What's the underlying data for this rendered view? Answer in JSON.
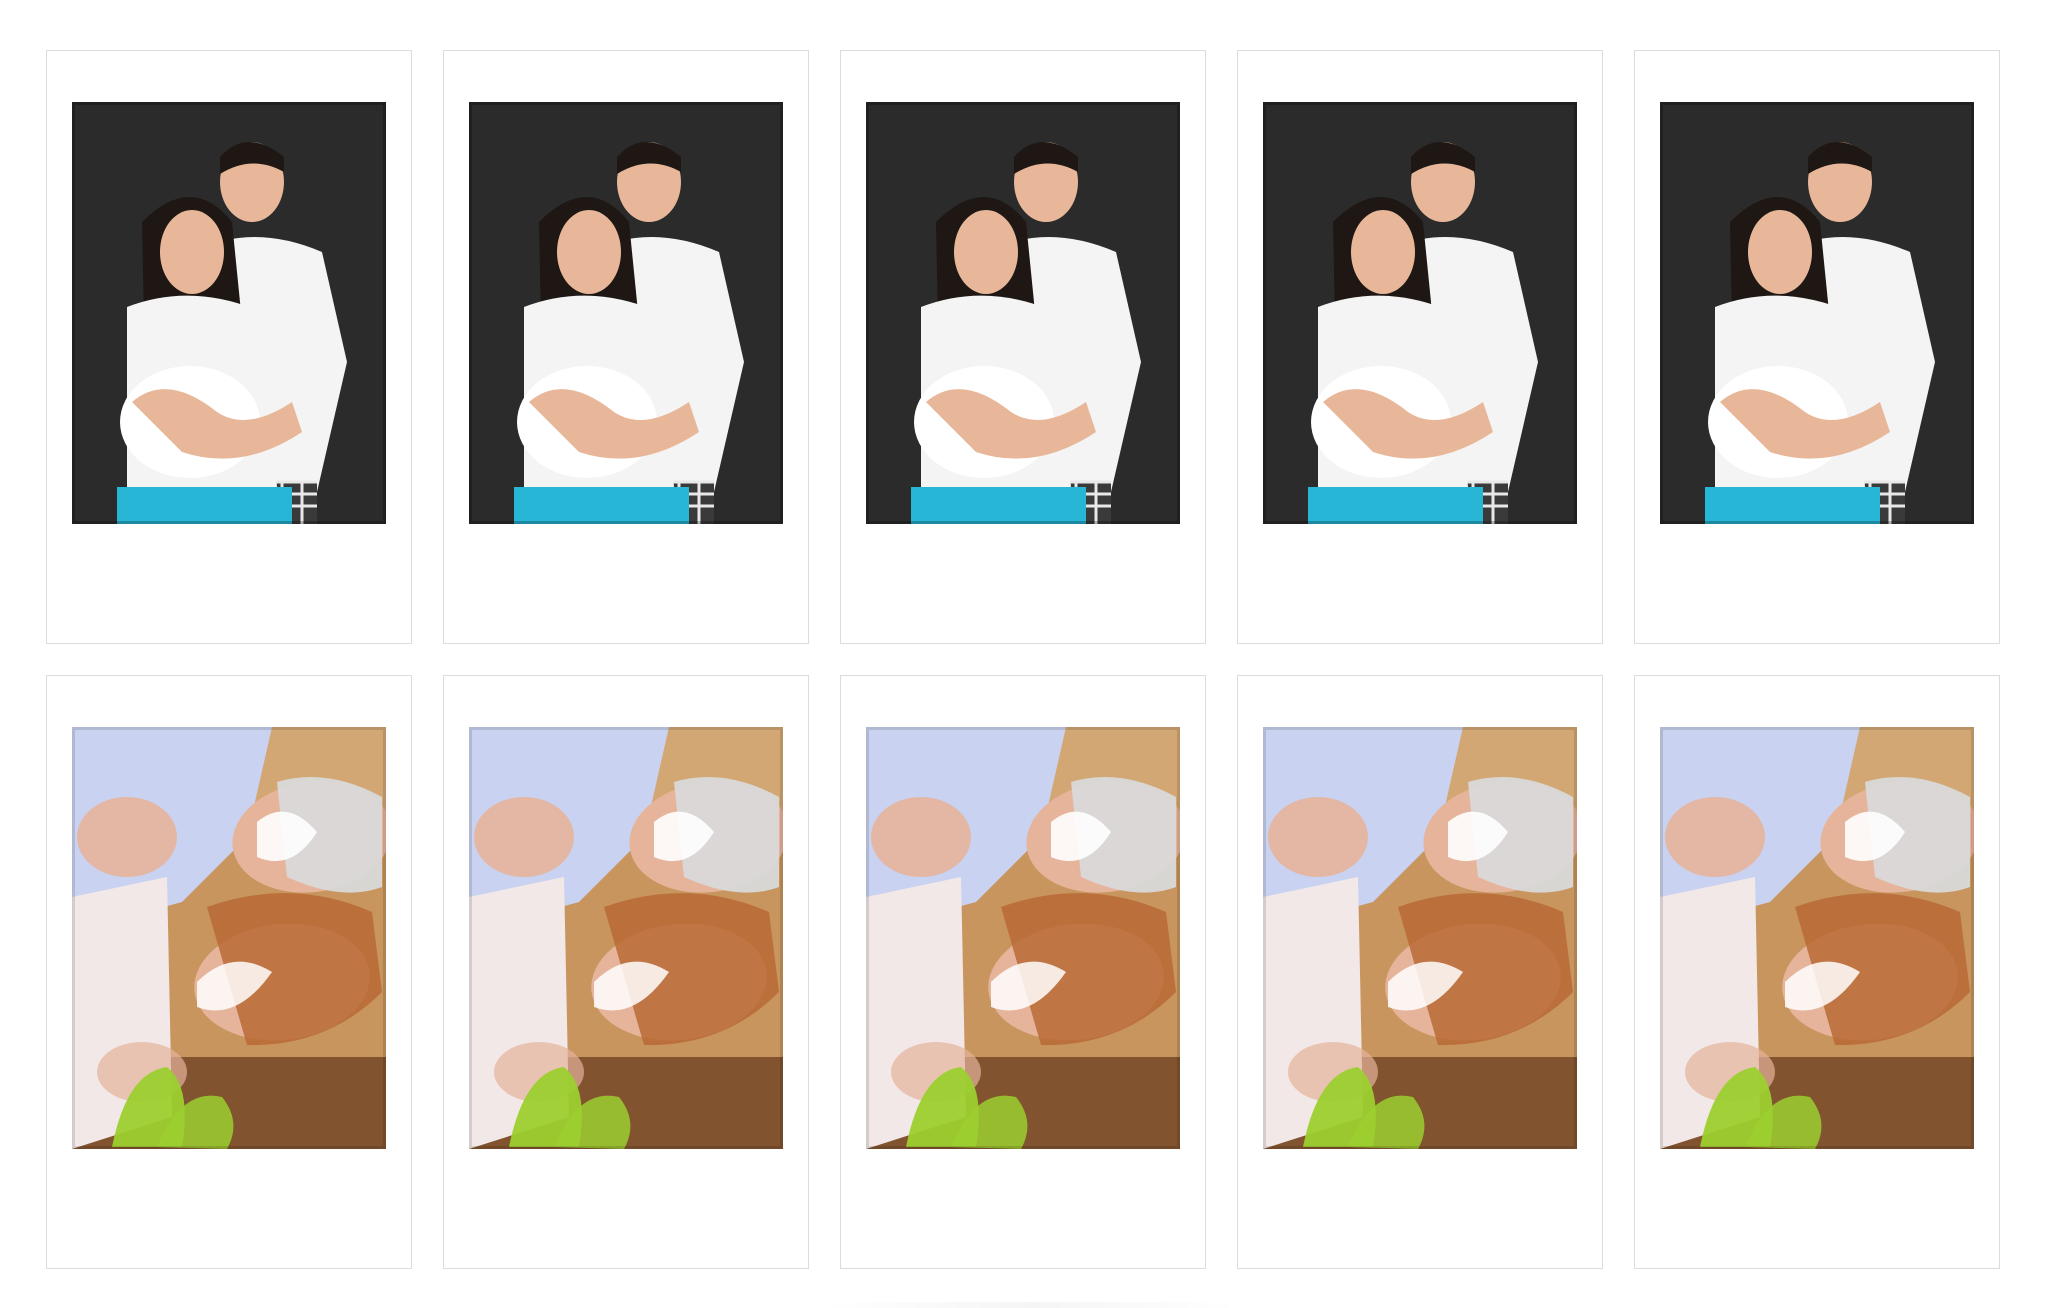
{
  "sheet": {
    "background": "#ffffff",
    "card_border_color": "#dcdcdc"
  },
  "rows": [
    {
      "photo": "pregnant-couple-photo",
      "count": 5,
      "palette": {
        "backdrop": "#2b2b2b",
        "shirt": "#f4f4f4",
        "skin": "#e8b79a",
        "hair": "#1e1713",
        "pants": "#27b6d6",
        "plaid": "#3a3a3a"
      }
    },
    {
      "photo": "senior-couple-photo",
      "count": 5,
      "palette": {
        "backdrop": "#c8955e",
        "shirt": "#c9d2f0",
        "skin": "#e6b49b",
        "hair_gray": "#d9d9d9",
        "hair_red": "#b96a36",
        "plant": "#9ccf2f"
      }
    }
  ]
}
